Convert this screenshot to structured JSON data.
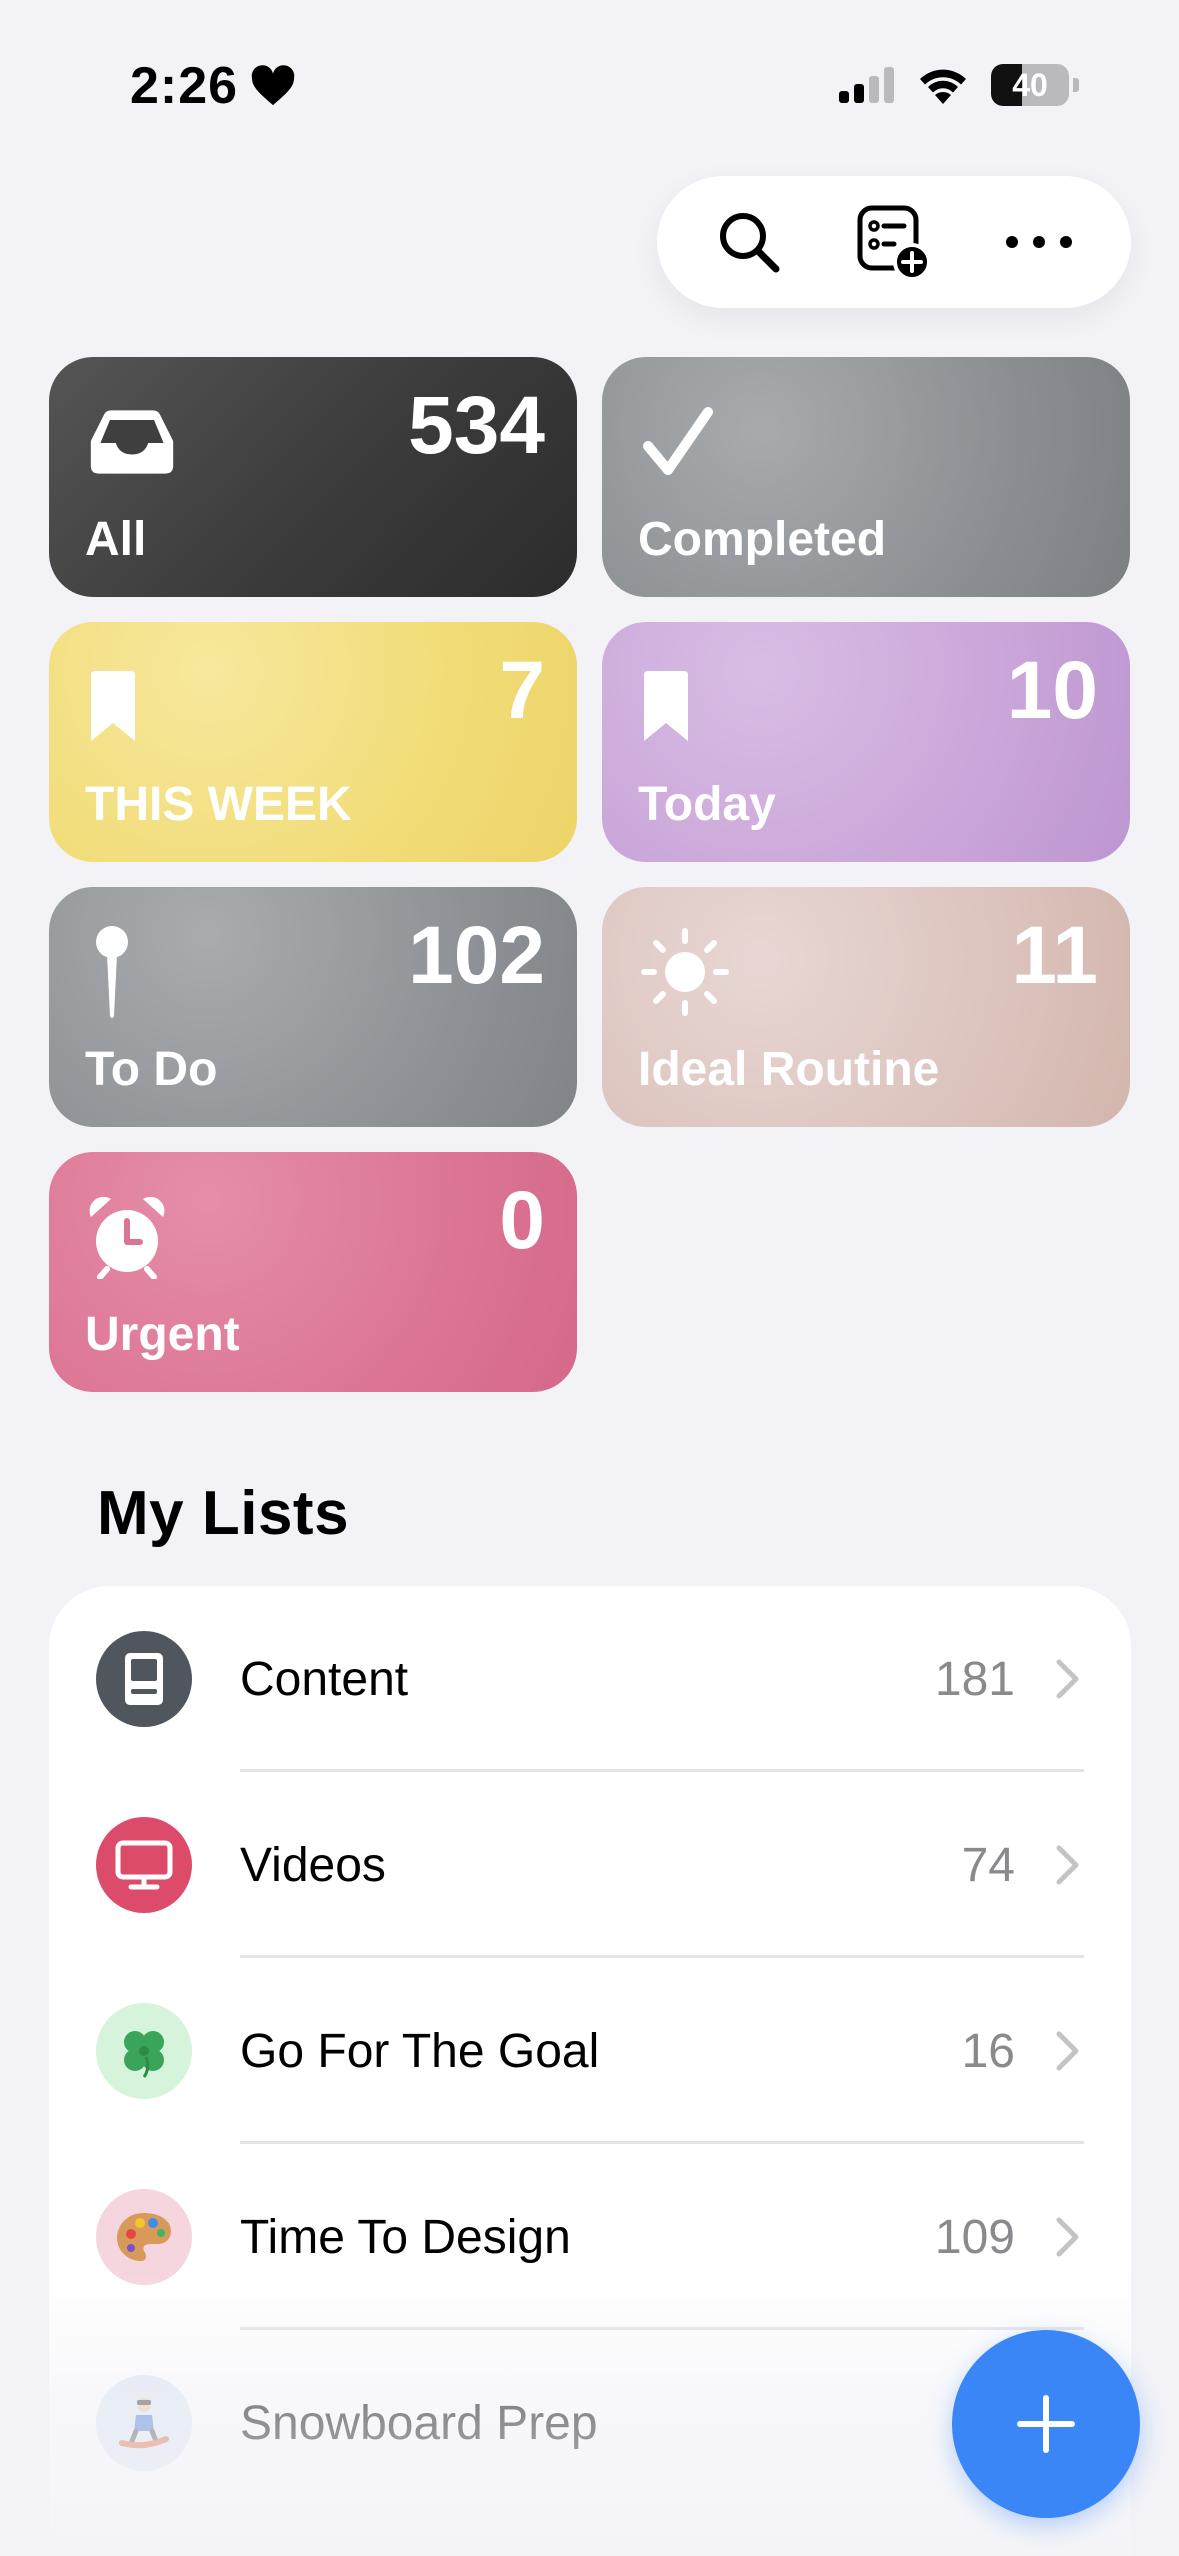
{
  "status_bar": {
    "time": "2:26",
    "battery_level": "40",
    "battery_fraction": 0.4
  },
  "toolbar": {
    "search_icon": "search-icon",
    "new_list_icon": "list-add-icon",
    "more_icon": "more-icon"
  },
  "smart_lists": [
    {
      "label": "All",
      "count": "534",
      "icon": "tray-icon",
      "color": "#3b3b3b"
    },
    {
      "label": "Completed",
      "count": "",
      "icon": "checkmark-icon",
      "color": "#8c9094"
    },
    {
      "label": "THIS WEEK",
      "count": "7",
      "icon": "bookmark-icon",
      "color": "#f1dc77"
    },
    {
      "label": "Today",
      "count": "10",
      "icon": "bookmark-icon",
      "color": "#c9a5d9"
    },
    {
      "label": "To Do",
      "count": "102",
      "icon": "pin-icon",
      "color": "#8f9397"
    },
    {
      "label": "Ideal Routine",
      "count": "11",
      "icon": "sun-icon",
      "color": "#dcc3bd"
    },
    {
      "label": "Urgent",
      "count": "0",
      "icon": "alarm-clock-icon",
      "color": "#dc7594"
    }
  ],
  "my_lists": {
    "title": "My Lists",
    "items": [
      {
        "name": "Content",
        "count": "181",
        "icon": "computer-icon",
        "color": "#4f565e"
      },
      {
        "name": "Videos",
        "count": "74",
        "icon": "display-icon",
        "color": "#dd4b6a"
      },
      {
        "name": "Go For The Goal",
        "count": "16",
        "icon": "four-leaf-clover-icon",
        "color": "#d6f3dc"
      },
      {
        "name": "Time To Design",
        "count": "109",
        "icon": "palette-icon",
        "color": "#f6d6de"
      },
      {
        "name": "Snowboard Prep",
        "count": "",
        "icon": "snowboarder-icon",
        "color": "#dfe8f3"
      }
    ]
  },
  "fab": {
    "icon": "plus-icon",
    "color": "#3b86f7"
  }
}
